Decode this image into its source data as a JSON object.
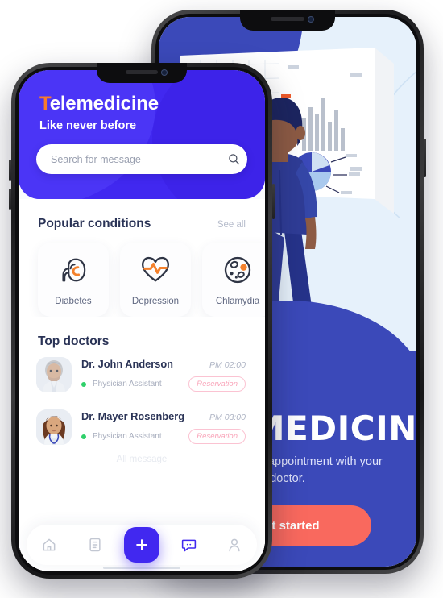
{
  "front_phone": {
    "header": {
      "app_title_first": "T",
      "app_title_rest": "elemedicine",
      "tagline": "Like never before",
      "search_placeholder": "Search for message",
      "search_value": "",
      "search_icon": "search-icon"
    },
    "popular": {
      "title": "Popular conditions",
      "see_all": "See all",
      "cards": [
        {
          "label": "Diabetes",
          "icon": "kidney-icon"
        },
        {
          "label": "Depression",
          "icon": "heart-pulse-icon"
        },
        {
          "label": "Chlamydia",
          "icon": "cell-icon"
        }
      ]
    },
    "doctors": {
      "title": "Top doctors",
      "list": [
        {
          "name": "Dr. John Anderson",
          "time": "PM 02:00",
          "role": "Physician Assistant",
          "status_color": "#2fd06a",
          "action": "Reservation"
        },
        {
          "name": "Dr. Mayer Rosenberg",
          "time": "PM 03:00",
          "role": "Physician Assistant",
          "status_color": "#2fd06a",
          "action": "Reservation"
        }
      ],
      "footer_text": "All message"
    },
    "tabbar": {
      "items": [
        {
          "name": "home-icon",
          "label": "Home",
          "active": false
        },
        {
          "name": "document-icon",
          "label": "Records",
          "active": false
        },
        {
          "name": "plus-icon",
          "label": "Add",
          "active": true
        },
        {
          "name": "chat-icon",
          "label": "Messages",
          "active": true
        },
        {
          "name": "person-icon",
          "label": "Profile",
          "active": false
        }
      ]
    },
    "colors": {
      "header_blue": "#4128f0",
      "accent_orange": "#fa7b2c",
      "badge_pink": "#f9a3b8",
      "status_green": "#2fd06a"
    }
  },
  "back_phone": {
    "title": "TELEMEDICINE",
    "subtitle": "Let's make an appointment with your doctor.",
    "cta_label": "Get started",
    "illustration": "doctor-viewing-medical-charts",
    "colors": {
      "panel_blue": "#3b49b9",
      "background_light": "#e6f1fb",
      "cta_coral": "#f9695e"
    }
  }
}
